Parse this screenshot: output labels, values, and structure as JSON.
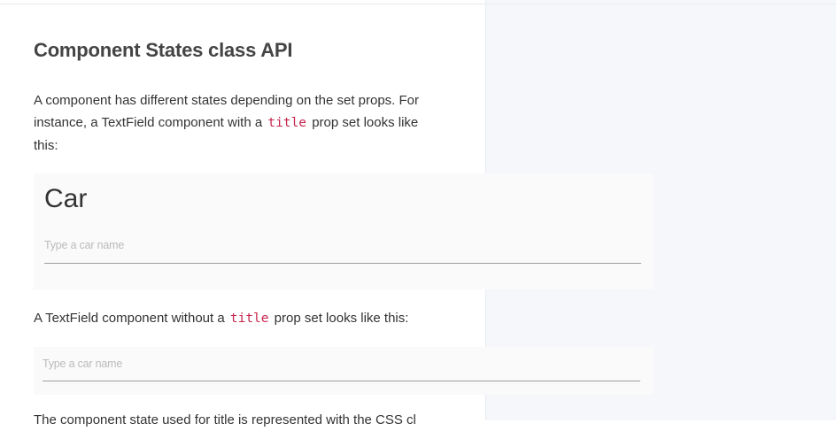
{
  "section": {
    "heading": "Component States class API",
    "intro_before_code": "A component has different states depending on the set props. For instance, a TextField component with a ",
    "intro_code": "title",
    "intro_after_code": " prop set looks like this:",
    "second_before_code": "A TextField component without a ",
    "second_code": "title",
    "second_after_code": " prop set looks like this:",
    "third_text": "The component state used for title is represented with the CSS cl"
  },
  "demo_with_title": {
    "title": "Car",
    "placeholder": "Type a car name"
  },
  "demo_without_title": {
    "placeholder": "Type a car name"
  }
}
